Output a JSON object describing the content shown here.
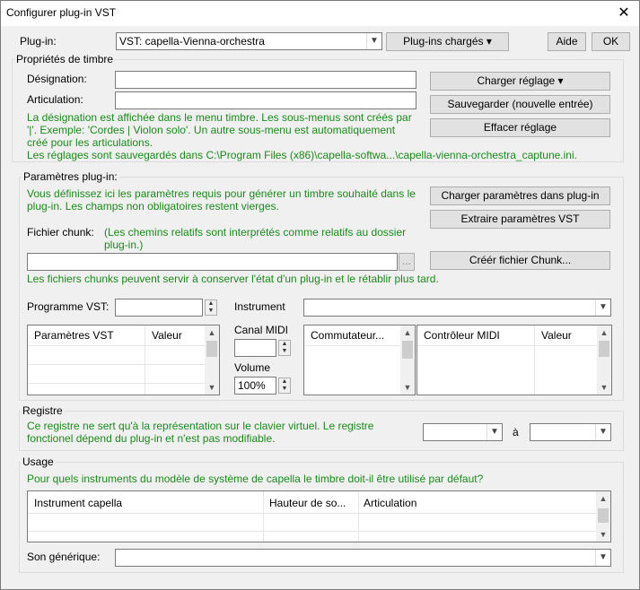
{
  "window": {
    "title": "Configurer plug-in VST",
    "close_glyph": "✕"
  },
  "top": {
    "plugin_label": "Plug-in:",
    "plugin_value": "VST: capella-Vienna-orchestra",
    "loaded_button": "Plug-ins chargés ▾",
    "help_button": "Aide",
    "ok_button": "OK"
  },
  "timbre": {
    "group_label": "Propriétés de timbre",
    "designation_label": "Désignation:",
    "designation_value": "",
    "articulation_label": "Articulation:",
    "articulation_value": "",
    "help_text": "La désignation est affichée dans le menu timbre. Les sous-menus sont créés par '|'. Exemple: 'Cordes | Violon solo'. Un autre sous-menu est automatiquement créé pour les articulations.",
    "saved_text": "Les réglages sont sauvegardés dans C:\\Program Files (x86)\\capella-softwa...\\capella-vienna-orchestra_captune.ini.",
    "load_button": "Charger réglage ▾",
    "save_button": "Sauvegarder (nouvelle entrée)",
    "delete_button": "Effacer réglage"
  },
  "params": {
    "group_label": "Paramètres plug-in:",
    "intro_text": "Vous définissez ici les paramètres requis pour générer un timbre souhaité dans le plug-in. Les champs non obligatoires restent vierges.",
    "load_params_button": "Charger paramètres dans plug-in",
    "extract_button": "Extraire paramètres VST",
    "chunk_label": "Fichier chunk:",
    "chunk_note": "(Les chemins relatifs sont interprétés comme relatifs au dossier plug-in.)",
    "chunk_value": "",
    "browse_button": "...",
    "create_chunk_button": "Créér fichier Chunk...",
    "chunk_info": "Les fichiers chunks peuvent servir à conserver l'état d'un plug-in et le rétablir plus tard.",
    "program_label": "Programme VST:",
    "program_value": "",
    "instrument_label": "Instrument",
    "instrument_value": "",
    "vst_table_headers": [
      "Paramètres VST",
      "Valeur"
    ],
    "midi_channel_label": "Canal MIDI",
    "midi_channel_value": "",
    "volume_label": "Volume",
    "volume_value": "100%",
    "switch_header": "Commutateur...",
    "controller_headers": [
      "Contrôleur MIDI",
      "Valeur"
    ]
  },
  "register": {
    "group_label": "Registre",
    "text": "Ce registre ne sert qu'à la représentation sur le clavier virtuel. Le registre fonctionel dépend du plug-in et n'est pas modifiable.",
    "from_value": "",
    "to_label": "à",
    "to_value": ""
  },
  "usage": {
    "group_label": "Usage",
    "question": "Pour quels instruments du modèle de système de capella le timbre doit-il être utilisé par défaut?",
    "table_headers": [
      "Instrument capella",
      "Hauteur de so...",
      "Articulation"
    ],
    "generic_label": "Son générique:",
    "generic_value": ""
  },
  "icons": {
    "dropdown": "chevron-down-icon",
    "scroll_up": "▲",
    "scroll_down": "▼",
    "spin_up": "▲",
    "spin_down": "▼"
  }
}
